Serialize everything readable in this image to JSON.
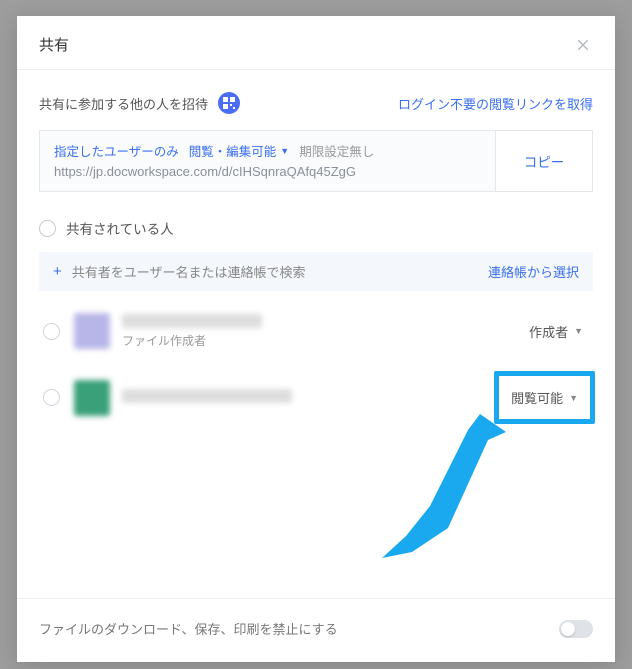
{
  "modal": {
    "title": "共有",
    "invite_label": "共有に参加する他の人を招待",
    "public_link_label": "ログイン不要の閲覧リンクを取得",
    "permission": {
      "scope": "指定したユーザーのみ",
      "mode": "閲覧・編集可能",
      "expiry": "期限設定無し"
    },
    "share_url": "https://jp.docworkspace.com/d/cIHSqnraQAfq45ZgG",
    "copy_label": "コピー",
    "shared_section_label": "共有されている人",
    "search_placeholder": "共有者をユーザー名または連絡帳で検索",
    "contacts_label": "連絡帳から選択",
    "people": [
      {
        "sub": "ファイル作成者",
        "role": "作成者"
      },
      {
        "sub": "",
        "role": "閲覧可能"
      }
    ],
    "footer_label": "ファイルのダウンロード、保存、印刷を禁止にする"
  },
  "colors": {
    "accent": "#3a6ff0",
    "highlight": "#1aa9ef"
  }
}
